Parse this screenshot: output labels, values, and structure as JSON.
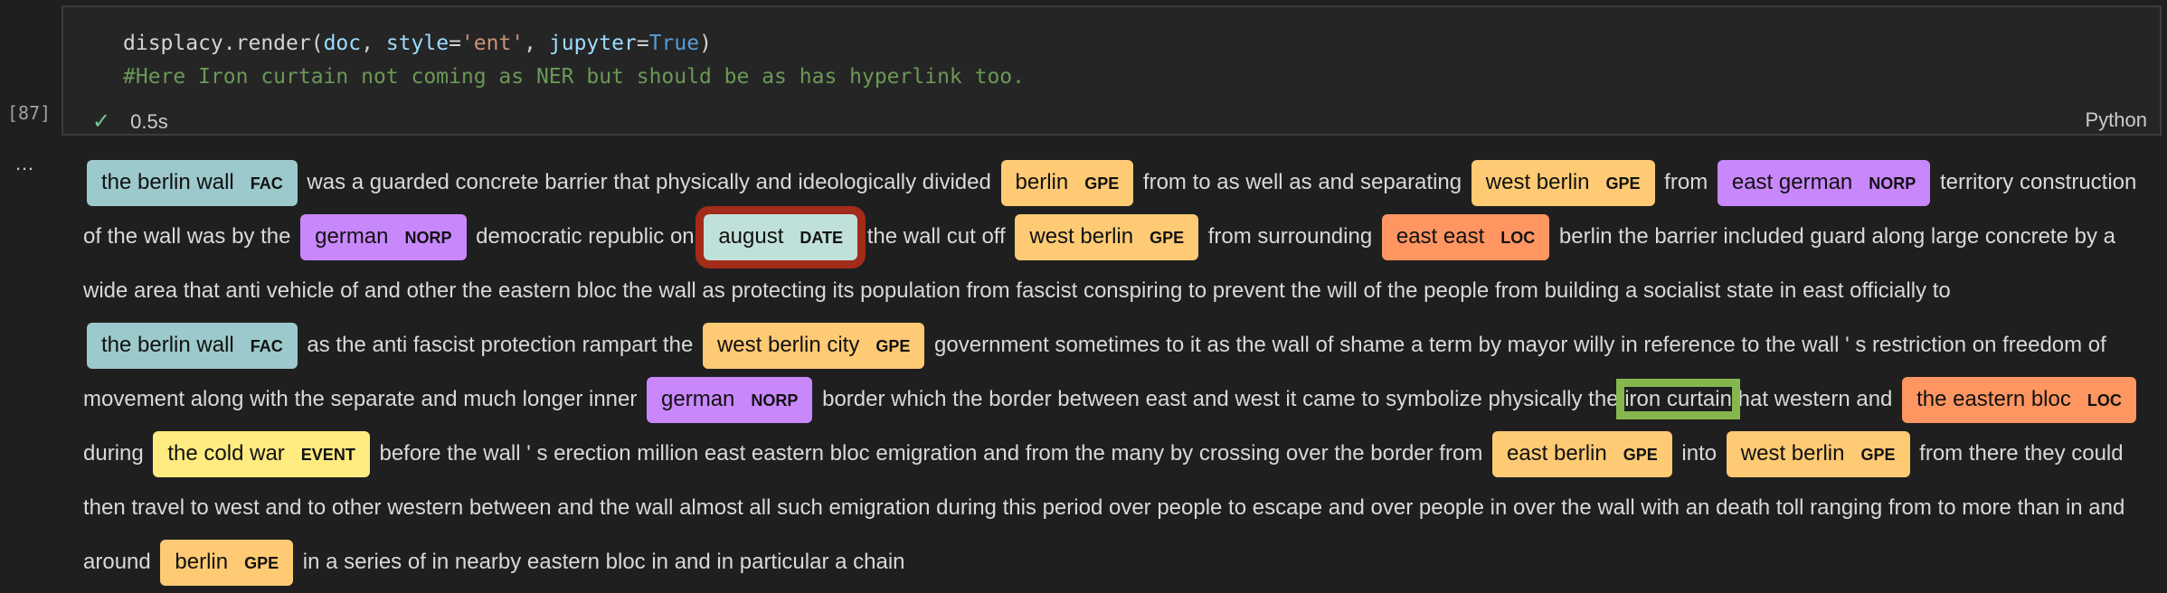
{
  "cell": {
    "execution_count": "[87]",
    "code_line1": {
      "p1": "displacy.render(",
      "arg1": "doc",
      "p2": ", ",
      "kw1": "style",
      "p3": "=",
      "str1": "'ent'",
      "p4": ", ",
      "kw2": "jupyter",
      "p5": "=",
      "val": "True",
      "p6": ")"
    },
    "code_line2": "#Here Iron curtain not coming as NER but should be as has hyperlink too.",
    "status_time": "0.5s",
    "language": "Python",
    "more_icon": "…"
  },
  "output": {
    "segments": [
      {
        "type": "ent",
        "text": "the berlin wall",
        "label": "FAC"
      },
      {
        "type": "text",
        "text": "was a guarded concrete barrier that physically and ideologically divided"
      },
      {
        "type": "ent",
        "text": "berlin",
        "label": "GPE"
      },
      {
        "type": "text",
        "text": "from to as well as and separating"
      },
      {
        "type": "ent",
        "text": "west berlin",
        "label": "GPE"
      },
      {
        "type": "text",
        "text": "from"
      },
      {
        "type": "ent",
        "text": "east german",
        "label": "NORP"
      },
      {
        "type": "text",
        "text": "territory construction of the wall was by the"
      },
      {
        "type": "ent",
        "text": "german",
        "label": "NORP"
      },
      {
        "type": "text",
        "text": "democratic republic on"
      },
      {
        "type": "ent",
        "text": "august",
        "label": "DATE"
      },
      {
        "type": "text",
        "text": "the wall cut off"
      },
      {
        "type": "ent",
        "text": "west berlin",
        "label": "GPE"
      },
      {
        "type": "text",
        "text": "from surrounding"
      },
      {
        "type": "ent",
        "text": "east east",
        "label": "LOC"
      },
      {
        "type": "text",
        "text": "berlin the barrier included guard along large concrete by a wide area that anti vehicle of and other the eastern bloc the wall as protecting its population from fascist conspiring to prevent the will of the people from building a socialist state in east officially to"
      },
      {
        "type": "ent",
        "text": "the berlin wall",
        "label": "FAC"
      },
      {
        "type": "text",
        "text": "as the anti fascist protection rampart the"
      },
      {
        "type": "ent",
        "text": "west berlin city",
        "label": "GPE"
      },
      {
        "type": "text",
        "text": "government sometimes to it as the wall of shame a term by mayor willy in reference to the wall ' s restriction on freedom of movement along with the separate and much longer inner"
      },
      {
        "type": "ent",
        "text": "german",
        "label": "NORP"
      },
      {
        "type": "text",
        "text": "border which the border between east and west it came to symbolize physically the"
      },
      {
        "type": "highlight",
        "text": "iron curtain"
      },
      {
        "type": "text",
        "text": "hat western and"
      },
      {
        "type": "ent",
        "text": "the eastern bloc",
        "label": "LOC"
      },
      {
        "type": "text",
        "text": "during"
      },
      {
        "type": "ent",
        "text": "the cold war",
        "label": "EVENT"
      },
      {
        "type": "text",
        "text": "before the wall ' s erection million east eastern bloc emigration and from the many by crossing over the border from"
      },
      {
        "type": "ent",
        "text": "east berlin",
        "label": "GPE"
      },
      {
        "type": "text",
        "text": "into"
      },
      {
        "type": "ent",
        "text": "west berlin",
        "label": "GPE"
      },
      {
        "type": "text",
        "text": "from there they could then travel to west and to other western between and the wall almost all such emigration during this period over people to escape and over people in over the wall with an death toll ranging from to more than in and around"
      },
      {
        "type": "ent",
        "text": "berlin",
        "label": "GPE"
      },
      {
        "type": "text",
        "text": "in a series of in nearby eastern bloc in and in particular a chain"
      }
    ],
    "entity_colors": {
      "FAC": "#9cc9cc",
      "GPE": "#feca74",
      "NORP": "#c887fb",
      "DATE": "#bfe1d9",
      "LOC": "#ff9561",
      "EVENT": "#ffeb80"
    },
    "annotation_colors": {
      "date_box": "#a32b19",
      "iron_curtain_box": "#86b74f"
    }
  }
}
